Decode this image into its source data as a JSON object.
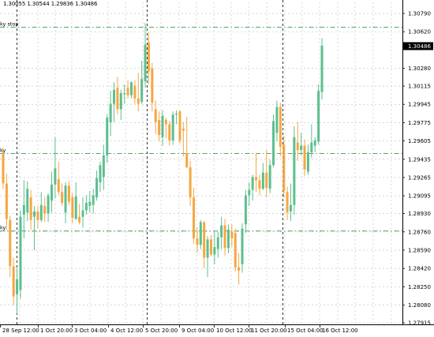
{
  "chart": {
    "ohlc_text": "1.30055 1.30544 1.29836 1.30486",
    "current_price": "1.30486",
    "price_labels": [
      "1.30790",
      "1.30620",
      "1.30280",
      "1.30115",
      "1.29945",
      "1.29775",
      "1.29605",
      "1.29435",
      "1.29265",
      "1.29095",
      "1.28930",
      "1.28760",
      "1.28590",
      "1.28420",
      "1.28250",
      "1.28080",
      "1.27915"
    ],
    "time_labels": [
      "28 Sep 12:00",
      "1 Oct 20:00",
      "3 Oct 04:00",
      "4 Oct 12:00",
      "5 Oct 20:00",
      "9 Oct 04:00",
      "10 Oct 12:00",
      "11 Oct 20:00",
      "15 Oct 04:00",
      "16 Oct 12:00"
    ],
    "order_lines": [
      {
        "label": "ky stop",
        "price": 1.30662
      },
      {
        "label": "ky",
        "price": 1.29489
      },
      {
        "label": "ky",
        "price": 1.28768
      }
    ],
    "colors": {
      "background": "#ffffff",
      "grid": "#c8c8c8",
      "bull_candle": "#5cbf8f",
      "bear_candle": "#f5a742",
      "order_line": "#3a9a4a",
      "period_separator": "#000000",
      "price_tag_bg": "#000000",
      "price_tag_text": "#ffffff"
    }
  },
  "chart_data": {
    "type": "candlestick",
    "y_range": [
      1.27915,
      1.3079
    ],
    "candles": [
      {
        "o": 1.2949,
        "h": 1.2954,
        "l": 1.2916,
        "c": 1.2921
      },
      {
        "o": 1.2921,
        "h": 1.293,
        "l": 1.2878,
        "c": 1.2888
      },
      {
        "o": 1.2887,
        "h": 1.2891,
        "l": 1.2834,
        "c": 1.2844
      },
      {
        "o": 1.2844,
        "h": 1.2852,
        "l": 1.2808,
        "c": 1.2816
      },
      {
        "o": 1.2818,
        "h": 1.2842,
        "l": 1.28,
        "c": 1.2832
      },
      {
        "o": 1.2822,
        "h": 1.2896,
        "l": 1.2814,
        "c": 1.289
      },
      {
        "o": 1.2892,
        "h": 1.2924,
        "l": 1.287,
        "c": 1.2901
      },
      {
        "o": 1.2894,
        "h": 1.2923,
        "l": 1.2886,
        "c": 1.2916
      },
      {
        "o": 1.2908,
        "h": 1.2915,
        "l": 1.2878,
        "c": 1.2887
      },
      {
        "o": 1.289,
        "h": 1.29,
        "l": 1.2859,
        "c": 1.2895
      },
      {
        "o": 1.2895,
        "h": 1.29,
        "l": 1.2879,
        "c": 1.2887
      },
      {
        "o": 1.2887,
        "h": 1.2913,
        "l": 1.2885,
        "c": 1.2901
      },
      {
        "o": 1.29,
        "h": 1.2908,
        "l": 1.2885,
        "c": 1.2893
      },
      {
        "o": 1.2893,
        "h": 1.2912,
        "l": 1.2885,
        "c": 1.291
      },
      {
        "o": 1.2905,
        "h": 1.2932,
        "l": 1.2894,
        "c": 1.292
      },
      {
        "o": 1.292,
        "h": 1.2964,
        "l": 1.2907,
        "c": 1.2935
      },
      {
        "o": 1.2925,
        "h": 1.2941,
        "l": 1.291,
        "c": 1.2913
      },
      {
        "o": 1.2913,
        "h": 1.2921,
        "l": 1.29,
        "c": 1.2903
      },
      {
        "o": 1.2894,
        "h": 1.2922,
        "l": 1.2884,
        "c": 1.2919
      },
      {
        "o": 1.2919,
        "h": 1.2923,
        "l": 1.2901,
        "c": 1.2904
      },
      {
        "o": 1.2908,
        "h": 1.2912,
        "l": 1.2884,
        "c": 1.2889
      },
      {
        "o": 1.2888,
        "h": 1.2922,
        "l": 1.2887,
        "c": 1.2909
      },
      {
        "o": 1.289,
        "h": 1.2902,
        "l": 1.2883,
        "c": 1.2885
      },
      {
        "o": 1.289,
        "h": 1.2908,
        "l": 1.288,
        "c": 1.2896
      },
      {
        "o": 1.2896,
        "h": 1.291,
        "l": 1.2892,
        "c": 1.2903
      },
      {
        "o": 1.29,
        "h": 1.2914,
        "l": 1.2894,
        "c": 1.2904
      },
      {
        "o": 1.2901,
        "h": 1.2916,
        "l": 1.2893,
        "c": 1.291
      },
      {
        "o": 1.2908,
        "h": 1.2933,
        "l": 1.2905,
        "c": 1.2926
      },
      {
        "o": 1.2922,
        "h": 1.2941,
        "l": 1.2913,
        "c": 1.2938
      },
      {
        "o": 1.2927,
        "h": 1.2957,
        "l": 1.2915,
        "c": 1.2947
      },
      {
        "o": 1.2947,
        "h": 1.2985,
        "l": 1.294,
        "c": 1.2982
      },
      {
        "o": 1.2978,
        "h": 1.3007,
        "l": 1.2965,
        "c": 1.2995
      },
      {
        "o": 1.2995,
        "h": 1.3015,
        "l": 1.2978,
        "c": 1.3008
      },
      {
        "o": 1.301,
        "h": 1.302,
        "l": 1.2985,
        "c": 1.299
      },
      {
        "o": 1.299,
        "h": 1.3008,
        "l": 1.298,
        "c": 1.3005
      },
      {
        "o": 1.3004,
        "h": 1.3013,
        "l": 1.2995,
        "c": 1.3005
      },
      {
        "o": 1.301,
        "h": 1.3017,
        "l": 1.3,
        "c": 1.3003
      },
      {
        "o": 1.3003,
        "h": 1.3016,
        "l": 1.3,
        "c": 1.3015
      },
      {
        "o": 1.3012,
        "h": 1.3017,
        "l": 1.2995,
        "c": 1.3
      },
      {
        "o": 1.3,
        "h": 1.3024,
        "l": 1.2988,
        "c": 1.2995
      },
      {
        "o": 1.2997,
        "h": 1.3035,
        "l": 1.2995,
        "c": 1.3018
      },
      {
        "o": 1.3016,
        "h": 1.307,
        "l": 1.301,
        "c": 1.305
      },
      {
        "o": 1.3052,
        "h": 1.3062,
        "l": 1.3013,
        "c": 1.3025
      },
      {
        "o": 1.3028,
        "h": 1.3033,
        "l": 1.2988,
        "c": 1.2996
      },
      {
        "o": 1.299,
        "h": 1.2998,
        "l": 1.2967,
        "c": 1.2978
      },
      {
        "o": 1.298,
        "h": 1.2988,
        "l": 1.296,
        "c": 1.2966
      },
      {
        "o": 1.2964,
        "h": 1.2989,
        "l": 1.2956,
        "c": 1.2984
      },
      {
        "o": 1.298,
        "h": 1.2982,
        "l": 1.2963,
        "c": 1.2976
      },
      {
        "o": 1.2976,
        "h": 1.2979,
        "l": 1.2956,
        "c": 1.2961
      },
      {
        "o": 1.2961,
        "h": 1.2988,
        "l": 1.2957,
        "c": 1.2985
      },
      {
        "o": 1.2985,
        "h": 1.2989,
        "l": 1.2976,
        "c": 1.2986
      },
      {
        "o": 1.2988,
        "h": 1.2989,
        "l": 1.2958,
        "c": 1.2961
      },
      {
        "o": 1.2972,
        "h": 1.2978,
        "l": 1.2946,
        "c": 1.297
      },
      {
        "o": 1.2949,
        "h": 1.2983,
        "l": 1.2935,
        "c": 1.2936
      },
      {
        "o": 1.2936,
        "h": 1.2942,
        "l": 1.29,
        "c": 1.2908
      },
      {
        "o": 1.2908,
        "h": 1.2917,
        "l": 1.2865,
        "c": 1.287
      },
      {
        "o": 1.287,
        "h": 1.288,
        "l": 1.2857,
        "c": 1.2864
      },
      {
        "o": 1.2864,
        "h": 1.2887,
        "l": 1.286,
        "c": 1.2885
      },
      {
        "o": 1.2885,
        "h": 1.2886,
        "l": 1.2842,
        "c": 1.2852
      },
      {
        "o": 1.2852,
        "h": 1.2872,
        "l": 1.2834,
        "c": 1.2869
      },
      {
        "o": 1.2869,
        "h": 1.2873,
        "l": 1.2853,
        "c": 1.2855
      },
      {
        "o": 1.2855,
        "h": 1.2876,
        "l": 1.2846,
        "c": 1.2862
      },
      {
        "o": 1.286,
        "h": 1.2876,
        "l": 1.2852,
        "c": 1.2871
      },
      {
        "o": 1.2871,
        "h": 1.289,
        "l": 1.286,
        "c": 1.2882
      },
      {
        "o": 1.2882,
        "h": 1.2888,
        "l": 1.2854,
        "c": 1.2861
      },
      {
        "o": 1.2861,
        "h": 1.2883,
        "l": 1.2856,
        "c": 1.2878
      },
      {
        "o": 1.2876,
        "h": 1.2883,
        "l": 1.2862,
        "c": 1.287
      },
      {
        "o": 1.2875,
        "h": 1.2879,
        "l": 1.2839,
        "c": 1.2843
      },
      {
        "o": 1.2843,
        "h": 1.2856,
        "l": 1.2827,
        "c": 1.284
      },
      {
        "o": 1.2846,
        "h": 1.2884,
        "l": 1.2838,
        "c": 1.2879
      },
      {
        "o": 1.2883,
        "h": 1.2915,
        "l": 1.2875,
        "c": 1.291
      },
      {
        "o": 1.291,
        "h": 1.2922,
        "l": 1.29,
        "c": 1.2915
      },
      {
        "o": 1.2915,
        "h": 1.2929,
        "l": 1.2905,
        "c": 1.2927
      },
      {
        "o": 1.2927,
        "h": 1.2949,
        "l": 1.2913,
        "c": 1.2924
      },
      {
        "o": 1.2924,
        "h": 1.2929,
        "l": 1.291,
        "c": 1.2916
      },
      {
        "o": 1.2916,
        "h": 1.294,
        "l": 1.2915,
        "c": 1.2931
      },
      {
        "o": 1.2931,
        "h": 1.2952,
        "l": 1.2908,
        "c": 1.2917
      },
      {
        "o": 1.2916,
        "h": 1.2943,
        "l": 1.2912,
        "c": 1.2938
      },
      {
        "o": 1.2938,
        "h": 1.2985,
        "l": 1.2936,
        "c": 1.2979
      },
      {
        "o": 1.2968,
        "h": 1.2998,
        "l": 1.296,
        "c": 1.2992
      },
      {
        "o": 1.2992,
        "h": 1.2996,
        "l": 1.2946,
        "c": 1.2955
      },
      {
        "o": 1.2957,
        "h": 1.2965,
        "l": 1.2908,
        "c": 1.2914
      },
      {
        "o": 1.2913,
        "h": 1.2918,
        "l": 1.2887,
        "c": 1.2894
      },
      {
        "o": 1.2895,
        "h": 1.2921,
        "l": 1.2886,
        "c": 1.2901
      },
      {
        "o": 1.2901,
        "h": 1.2974,
        "l": 1.2892,
        "c": 1.2964
      },
      {
        "o": 1.2959,
        "h": 1.2978,
        "l": 1.2942,
        "c": 1.2952
      },
      {
        "o": 1.2952,
        "h": 1.2968,
        "l": 1.2947,
        "c": 1.2956
      },
      {
        "o": 1.2956,
        "h": 1.2962,
        "l": 1.2928,
        "c": 1.2934
      },
      {
        "o": 1.2932,
        "h": 1.2957,
        "l": 1.2929,
        "c": 1.295
      },
      {
        "o": 1.295,
        "h": 1.2976,
        "l": 1.2945,
        "c": 1.2959
      },
      {
        "o": 1.2956,
        "h": 1.2964,
        "l": 1.295,
        "c": 1.2961
      },
      {
        "o": 1.296,
        "h": 1.3013,
        "l": 1.2957,
        "c": 1.3007
      },
      {
        "o": 1.3006,
        "h": 1.3056,
        "l": 1.2999,
        "c": 1.3049
      }
    ]
  }
}
